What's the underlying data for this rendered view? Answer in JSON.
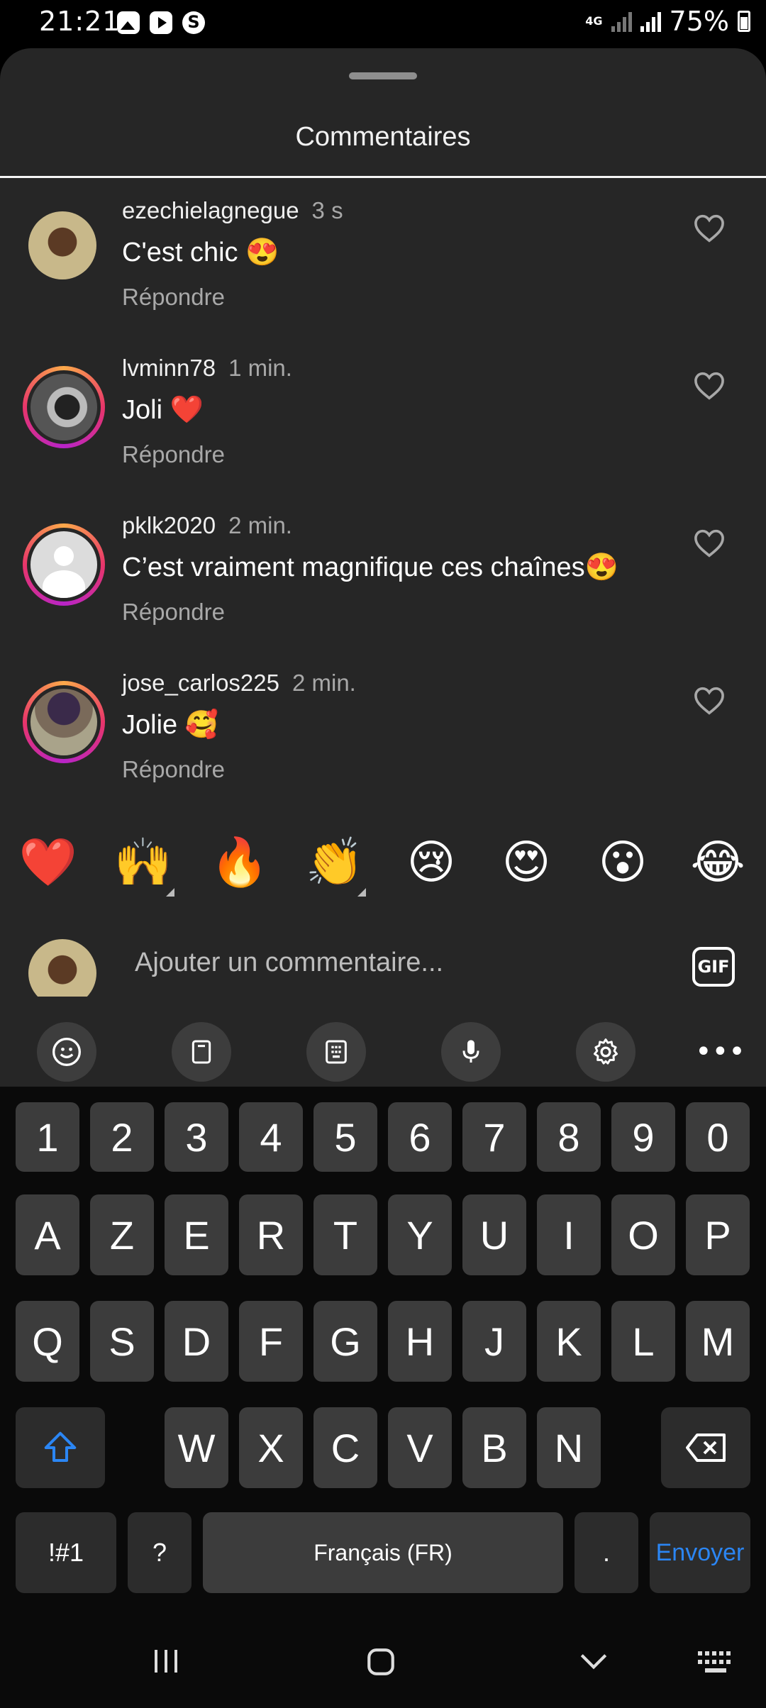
{
  "status_bar": {
    "time": "21:21",
    "network": "4G",
    "battery": "75%"
  },
  "sheet": {
    "title": "Commentaires"
  },
  "comments": [
    {
      "username": "ezechielagnegue",
      "time": "3 s",
      "text": "C'est chic 😍",
      "reply": "Répondre"
    },
    {
      "username": "lvminn78",
      "time": "1 min.",
      "text": "Joli ❤️",
      "reply": "Répondre"
    },
    {
      "username": "pklk2020",
      "time": "2 min.",
      "text": "C’est vraiment magnifique ces chaînes😍",
      "reply": "Répondre"
    },
    {
      "username": "jose_carlos225",
      "time": "2 min.",
      "text": "Jolie 🥰",
      "reply": "Répondre"
    }
  ],
  "quick_reactions": [
    "❤️",
    "🙌",
    "🔥",
    "👏",
    "😢",
    "😍",
    "😮",
    "😂"
  ],
  "composer": {
    "placeholder": "Ajouter un commentaire...",
    "gif_label": "GIF"
  },
  "keyboard": {
    "row1": [
      "1",
      "2",
      "3",
      "4",
      "5",
      "6",
      "7",
      "8",
      "9",
      "0"
    ],
    "row2": [
      "A",
      "Z",
      "E",
      "R",
      "T",
      "Y",
      "U",
      "I",
      "O",
      "P"
    ],
    "row3": [
      "Q",
      "S",
      "D",
      "F",
      "G",
      "H",
      "J",
      "K",
      "L",
      "M"
    ],
    "row4": [
      "W",
      "X",
      "C",
      "V",
      "B",
      "N"
    ],
    "symbols_label": "!#1",
    "question_label": "?",
    "space_label": "Français (FR)",
    "period_label": ".",
    "send_label": "Envoyer"
  },
  "colors": {
    "sheet_bg": "#262626",
    "key_bg": "#3c3c3c",
    "accent_blue": "#2b86f4"
  }
}
